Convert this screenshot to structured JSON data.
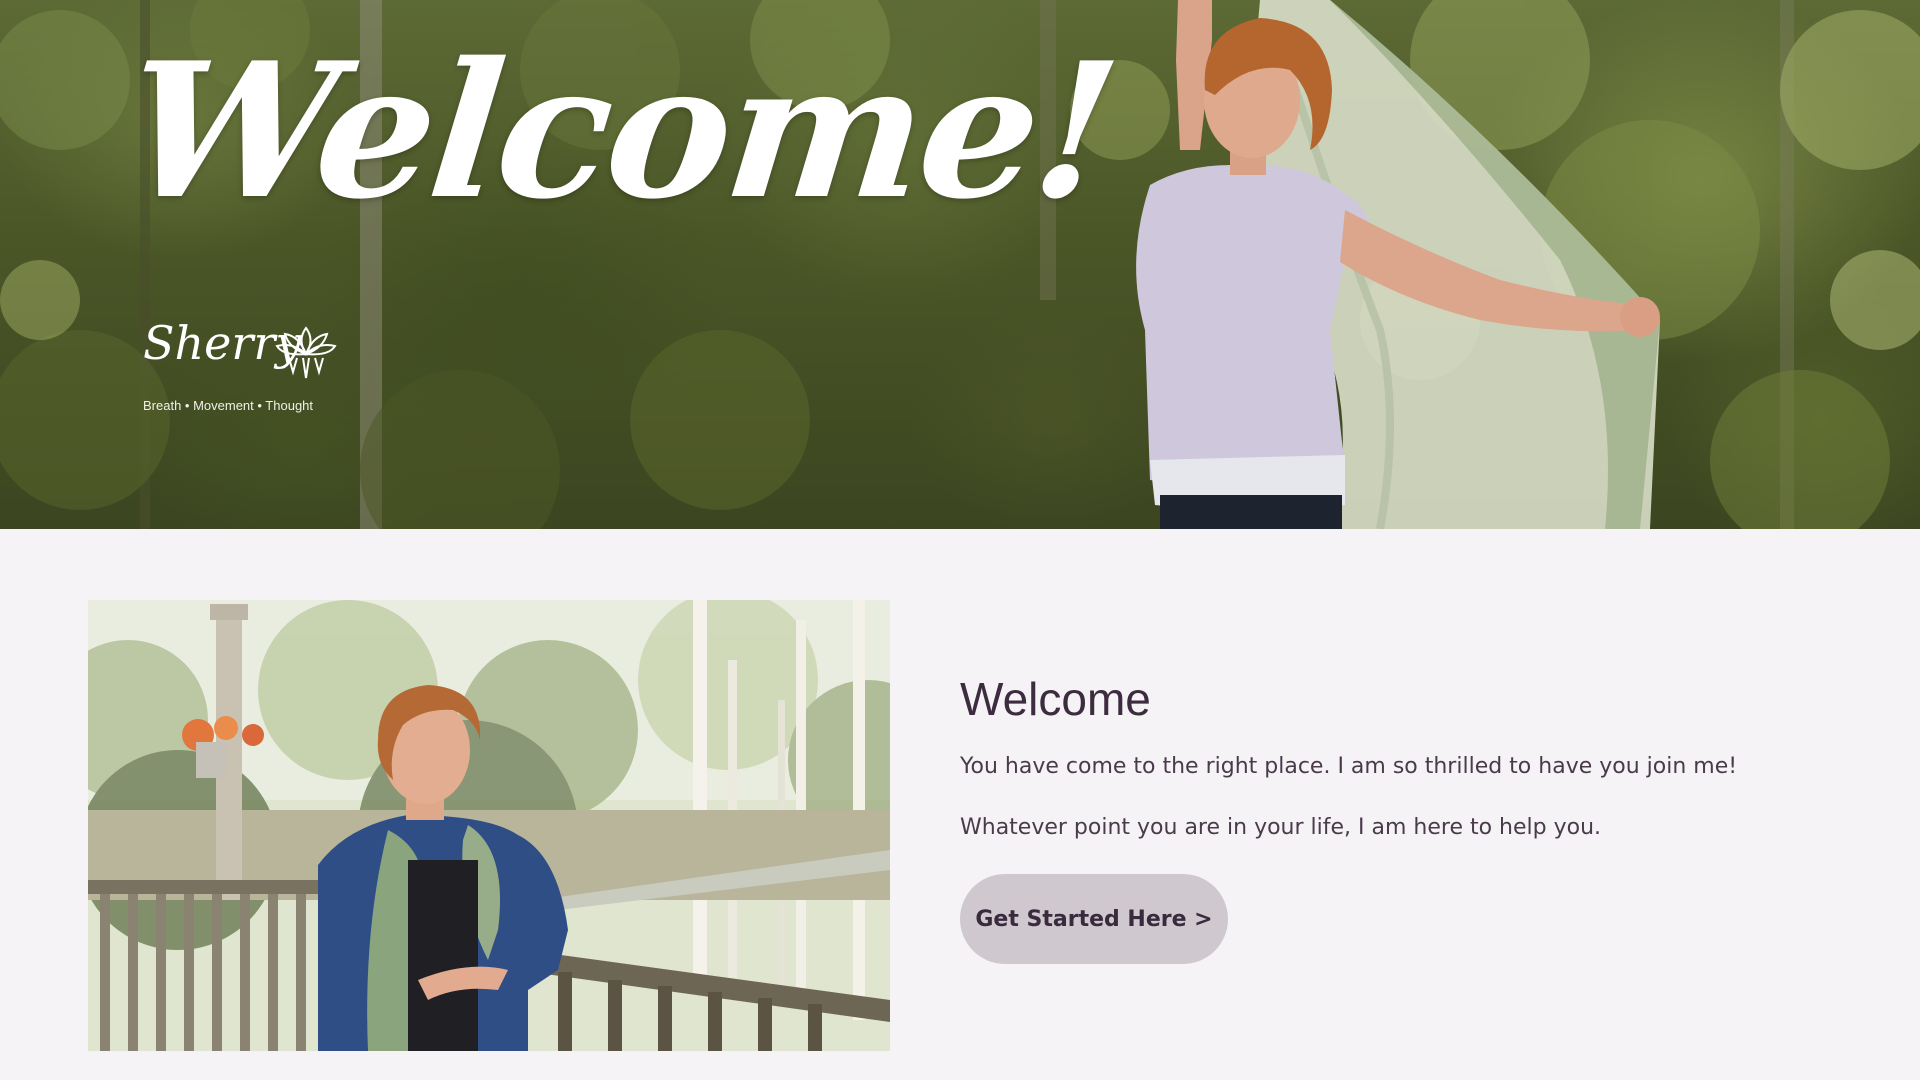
{
  "hero": {
    "welcome": "Welcome!",
    "brand": {
      "name": "Sherry",
      "tagline": "Breath  •  Movement  •  Thought"
    }
  },
  "intro": {
    "heading": "Welcome",
    "paragraph_1": "You have come to the right place. I am so thrilled to have you join me!",
    "paragraph_2": "Whatever point you are in your life, I am here to help you.",
    "cta_label": "Get Started Here >"
  },
  "colors": {
    "page_background": "#f6f3f7",
    "heading": "#3d2b3f",
    "body_text": "#4a3b4b",
    "button_background": "#cfc8cf",
    "button_text": "#3a2a3d"
  },
  "icons": {
    "brand_mark": "lotus-icon"
  }
}
